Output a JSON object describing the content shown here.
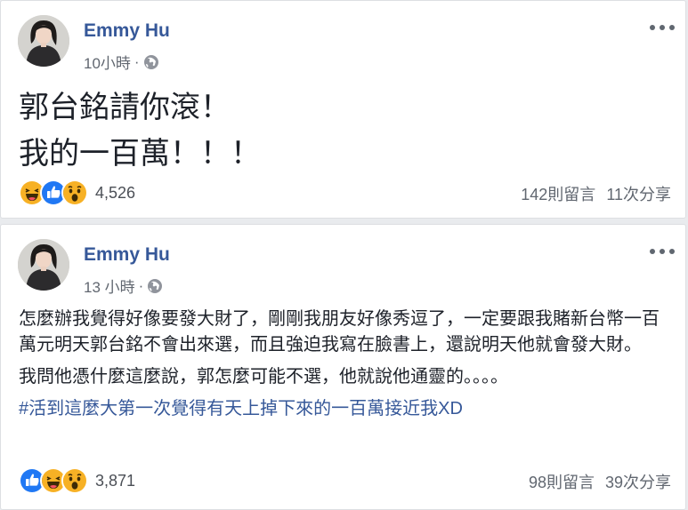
{
  "colors": {
    "author_link": "#365899",
    "meta_gray": "#616770",
    "body_text": "#1d2129",
    "hashtag": "#365899",
    "like_blue": "#2078f4",
    "haha_yellow": "#f7b125"
  },
  "posts": [
    {
      "author": "Emmy Hu",
      "time": "10小時",
      "separator": "·",
      "privacy_icon": "globe-icon",
      "lines": [
        "郭台銘請你滾！",
        "我的一百萬！！！"
      ],
      "reactions": [
        "haha-icon",
        "like-icon",
        "wow-icon"
      ],
      "reaction_count": "4,526",
      "comments": "142則留言",
      "shares": "11次分享"
    },
    {
      "author": "Emmy Hu",
      "time": "13 小時",
      "separator": "·",
      "privacy_icon": "globe-icon",
      "paragraphs": [
        "怎麼辦我覺得好像要發大財了，剛剛我朋友好像秀逗了，一定要跟我賭新台幣一百萬元明天郭台銘不會出來選，而且強迫我寫在臉書上，還說明天他就會發大財。",
        "我問他憑什麼這麼說，郭怎麼可能不選，他就說他通靈的。。。。"
      ],
      "hashtag": "#活到這麼大第一次覺得有天上掉下來的一百萬接近我XD",
      "reactions": [
        "like-icon",
        "haha-icon",
        "wow-icon"
      ],
      "reaction_count": "3,871",
      "comments": "98則留言",
      "shares": "39次分享"
    }
  ]
}
